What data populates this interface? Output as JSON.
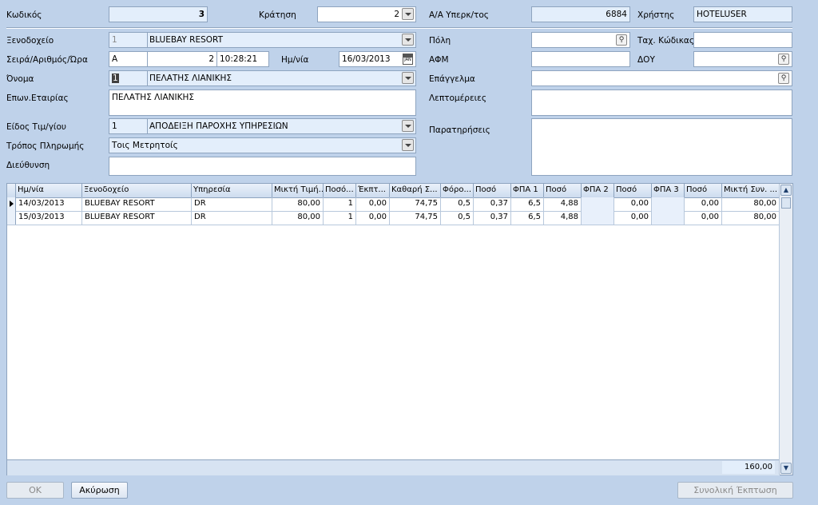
{
  "header": {
    "code_label": "Κωδικός",
    "code_value": "3",
    "booking_label": "Κράτηση",
    "booking_value": "2",
    "voucher_label": "Α/Α Υπερκ/τος",
    "voucher_value": "6884",
    "user_label": "Χρήστης",
    "user_value": "HOTELUSER"
  },
  "form": {
    "hotel_label": "Ξενοδοχείο",
    "hotel_code": "1",
    "hotel_name": "BLUEBAY RESORT",
    "series_label": "Σειρά/Αριθμός/Ώρα",
    "series_value": "A",
    "number_value": "2",
    "time_value": "10:28:21",
    "date_label": "Ημ/νία",
    "date_value": "16/03/2013",
    "cal_text": "JAN",
    "name_label": "Όνομα",
    "name_code": "1",
    "name_value": "ΠΕΛΑΤΗΣ ΛΙΑΝΙΚΗΣ",
    "company_label": "Επων.Εταιρίας",
    "company_value": "ΠΕΛΑΤΗΣ ΛΙΑΝΙΚΗΣ",
    "doctype_label": "Είδος Τιμ/γίου",
    "doctype_code": "1",
    "doctype_value": "ΑΠΟΔΕΙΞΗ ΠΑΡΟΧΗΣ ΥΠΗΡΕΣΙΩΝ",
    "payment_label": "Τρόπος Πληρωμής",
    "payment_value": "Τοις Μετρητοίς",
    "address_label": "Διεύθυνση",
    "address_value": "",
    "city_label": "Πόλη",
    "city_value": "",
    "zip_label": "Ταχ. Κώδικας",
    "zip_value": "",
    "vat_label": "ΑΦΜ",
    "vat_value": "",
    "taxoffice_label": "ΔΟΥ",
    "taxoffice_value": "",
    "profession_label": "Επάγγελμα",
    "profession_value": "",
    "details_label": "Λεπτομέρειες",
    "details_value": "",
    "notes_label": "Παρατηρήσεις",
    "notes_value": ""
  },
  "grid": {
    "columns": [
      "Ημ/νία",
      "Ξενοδοχείο",
      "Υπηρεσία",
      "Μικτή Τιμή...",
      "Ποσό...",
      "Έκπτ...",
      "Καθαρή Σ...",
      "Φόρο...",
      "Ποσό",
      "ΦΠΑ 1",
      "Ποσό",
      "ΦΠΑ 2",
      "Ποσό",
      "ΦΠΑ 3",
      "Ποσό",
      "Μικτή Συν. ..."
    ],
    "rows": [
      [
        "14/03/2013",
        "BLUEBAY RESORT",
        "DR",
        "80,00",
        "1",
        "0,00",
        "74,75",
        "0,5",
        "0,37",
        "6,5",
        "4,88",
        "",
        "0,00",
        "",
        "0,00",
        "80,00"
      ],
      [
        "15/03/2013",
        "BLUEBAY RESORT",
        "DR",
        "80,00",
        "1",
        "0,00",
        "74,75",
        "0,5",
        "0,37",
        "6,5",
        "4,88",
        "",
        "0,00",
        "",
        "0,00",
        "80,00"
      ]
    ],
    "total": "160,00"
  },
  "buttons": {
    "ok": "OK",
    "cancel": "Ακύρωση",
    "discount": "Συνολική Έκπτωση"
  },
  "icons": {
    "up": "▲",
    "down": "▼",
    "lookup": "⚲"
  }
}
